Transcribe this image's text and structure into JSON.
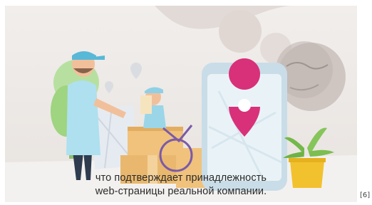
{
  "video": {
    "subtitle_line1": "что подтверждает принадлежность",
    "subtitle_line2": "web-страницы реальной компании.",
    "scene_icons": [
      "map-pin-icon",
      "globe-icon",
      "smartphone-icon"
    ]
  },
  "reference": "[6]",
  "colors": {
    "pin": "#d9307a",
    "sky": "#b8dce7",
    "box": "#e9b86e",
    "plant": "#9bd36b"
  }
}
